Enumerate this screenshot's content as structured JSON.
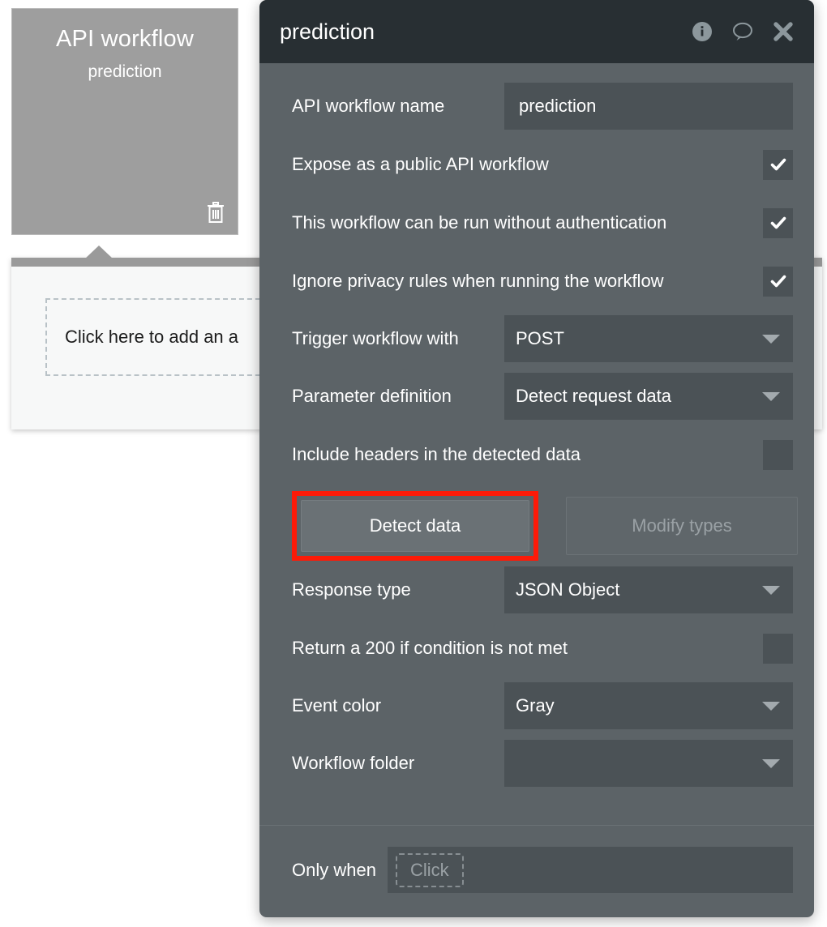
{
  "canvas": {
    "event_card": {
      "title": "API workflow",
      "subtitle": "prediction",
      "delete_icon": "trash-icon"
    },
    "action_card": {
      "placeholder": "Click here to add an a"
    }
  },
  "panel": {
    "header": {
      "title": "prediction",
      "icons": [
        {
          "name": "info-icon"
        },
        {
          "name": "comment-icon"
        },
        {
          "name": "close-icon"
        }
      ]
    },
    "fields": {
      "workflow_name_label": "API workflow name",
      "workflow_name_value": "prediction",
      "expose_public_label": "Expose as a public API workflow",
      "expose_public_checked": "✓",
      "no_auth_label": "This workflow can be run without authentication",
      "no_auth_checked": "✓",
      "ignore_privacy_label": "Ignore privacy rules when running the workflow",
      "ignore_privacy_checked": "✓",
      "trigger_label": "Trigger workflow with",
      "trigger_value": "POST",
      "param_def_label": "Parameter definition",
      "param_def_value": "Detect request data",
      "include_headers_label": "Include headers in the detected data",
      "detect_data_button": "Detect data",
      "modify_types_button": "Modify types",
      "response_type_label": "Response type",
      "response_type_value": "JSON Object",
      "return_200_label": "Return a 200 if condition is not met",
      "event_color_label": "Event color",
      "event_color_value": "Gray",
      "workflow_folder_label": "Workflow folder",
      "workflow_folder_value": ""
    },
    "footer": {
      "only_when_label": "Only when",
      "only_when_placeholder": "Click"
    }
  },
  "colors": {
    "panel_bg": "#5c6367",
    "header_bg": "#282f33",
    "field_bg": "#4b5256",
    "highlight_red": "#fc1b08",
    "card_gray": "#9e9e9e"
  }
}
